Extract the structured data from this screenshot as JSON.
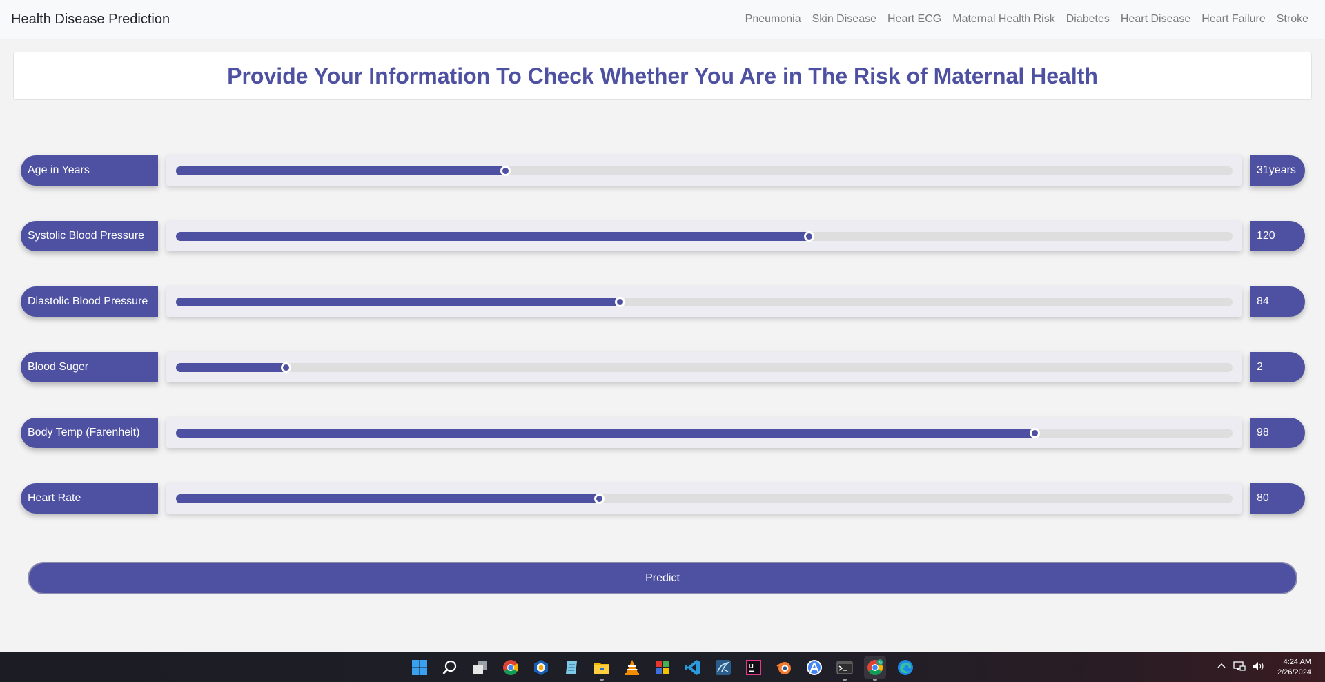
{
  "navbar": {
    "brand": "Health Disease Prediction",
    "links": [
      "Pneumonia",
      "Skin Disease",
      "Heart ECG",
      "Maternal Health Risk",
      "Diabetes",
      "Heart Disease",
      "Heart Failure",
      "Stroke"
    ]
  },
  "header": {
    "title": "Provide Your Information To Check Whether You Are in The Risk of Maternal Health"
  },
  "form": {
    "fields": [
      {
        "label": "Age in Years",
        "value": "31",
        "unit": "years",
        "fill_fraction": 0.312
      },
      {
        "label": "Systolic Blood Pressure",
        "value": "120",
        "unit": "",
        "fill_fraction": 0.599
      },
      {
        "label": "Diastolic Blood Pressure",
        "value": "84",
        "unit": "",
        "fill_fraction": 0.42
      },
      {
        "label": "Blood Suger",
        "value": "2",
        "unit": "",
        "fill_fraction": 0.104
      },
      {
        "label": "Body Temp (Farenheit)",
        "value": "98",
        "unit": "",
        "fill_fraction": 0.813
      },
      {
        "label": "Heart Rate",
        "value": "80",
        "unit": "",
        "fill_fraction": 0.401
      }
    ],
    "predict_label": "Predict"
  },
  "colors": {
    "accent": "#4e51a1",
    "track": "#dedede",
    "page_bg": "#f3f3f3"
  },
  "taskbar": {
    "icons": [
      "windows-start-icon",
      "search-icon",
      "task-view-icon",
      "chrome-icon",
      "virtualbox-icon",
      "notepad-icon",
      "file-explorer-icon",
      "vlc-icon",
      "app-grid-icon",
      "vscode-icon",
      "mysql-workbench-icon",
      "intellij-icon",
      "blender-icon",
      "android-studio-icon",
      "terminal-icon",
      "chrome-profile-icon",
      "edge-icon"
    ],
    "clock": {
      "time": "4:24 AM",
      "date": "2/26/2024"
    }
  }
}
